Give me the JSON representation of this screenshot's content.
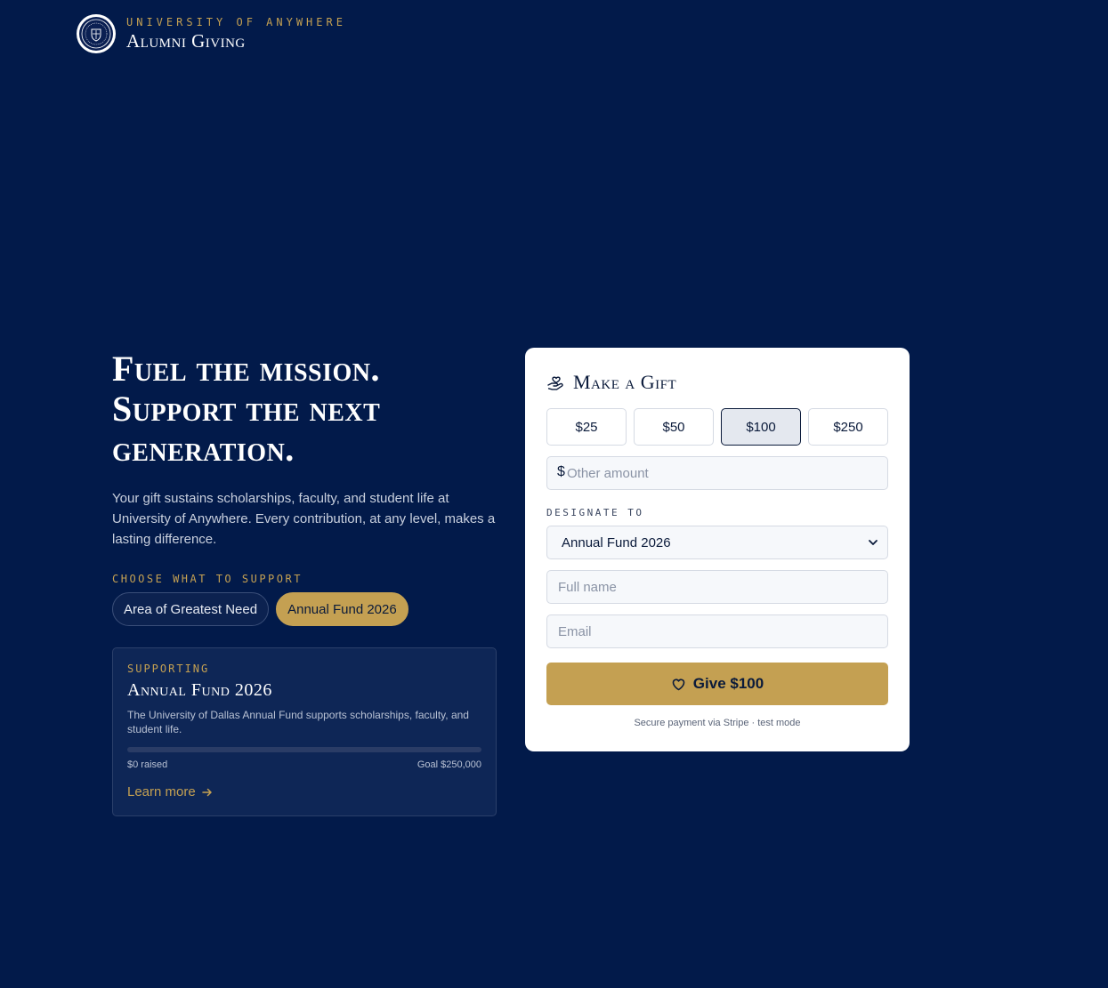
{
  "header": {
    "university": "UNIVERSITY OF ANYWHERE",
    "title": "Alumni Giving"
  },
  "hero": {
    "line1": "Fuel the mission.",
    "line2": "Support the next",
    "line3": "generation.",
    "lede": "Your gift sustains scholarships, faculty, and student life at University of Anywhere. Every contribution, at any level, makes a lasting difference."
  },
  "choose": {
    "label": "CHOOSE WHAT TO SUPPORT",
    "options": [
      "Area of Greatest Need",
      "Annual Fund 2026"
    ],
    "selected": "Annual Fund 2026"
  },
  "supporting": {
    "label": "SUPPORTING",
    "title": "Annual Fund 2026",
    "description": "The University of Dallas Annual Fund supports scholarships, faculty, and student life.",
    "raised": "$0 raised",
    "goal": "Goal $250,000",
    "progress_fraction": 0,
    "learn_more": "Learn more"
  },
  "gift": {
    "title": "Make a Gift",
    "amounts": [
      "$25",
      "$50",
      "$100",
      "$250"
    ],
    "selected_amount": "$100",
    "other_prefix": "$",
    "other_placeholder": "Other amount",
    "designate_label": "DESIGNATE TO",
    "designation": "Annual Fund 2026",
    "name_placeholder": "Full name",
    "email_placeholder": "Email",
    "give_label": "Give $100",
    "secure_note": "Secure payment via Stripe · test mode"
  },
  "colors": {
    "background": "#021a4a",
    "accent_gold": "#c4a052",
    "card": "#ffffff"
  },
  "icons": [
    "seal-logo",
    "hand-heart-icon",
    "heart-icon",
    "arrow-right-icon",
    "chevron-down-icon"
  ]
}
